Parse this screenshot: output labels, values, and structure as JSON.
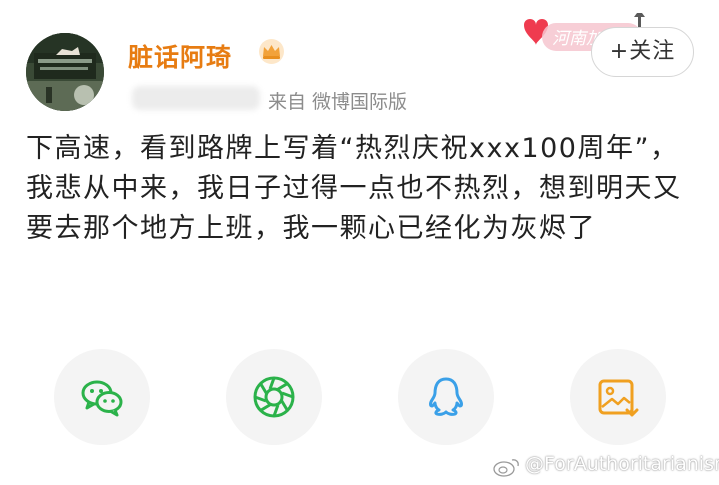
{
  "user": {
    "name": "脏话阿琦",
    "source": "来自 微博国际版"
  },
  "badge": {
    "text": "河南加"
  },
  "follow_button": {
    "label": "+关注"
  },
  "post": {
    "text": "下高速，看到路牌上写着“热烈庆祝xxx100周年”，我悲从中来，我日子过得一点也不热烈，想到明天又要去那个地方上班，我一颗心已经化为灰烬了"
  },
  "share": [
    {
      "icon": "wechat-icon",
      "color": "#2bb24a"
    },
    {
      "icon": "moments-icon",
      "color": "#2bb24a"
    },
    {
      "icon": "qq-icon",
      "color": "#3aa0e8"
    },
    {
      "icon": "save-image-icon",
      "color": "#f0a020"
    }
  ],
  "watermark": {
    "text": "@ForAuthoritarianism"
  },
  "colors": {
    "username": "#e77c12",
    "source": "#8c8c8c",
    "button_bg": "#f4f4f4"
  }
}
